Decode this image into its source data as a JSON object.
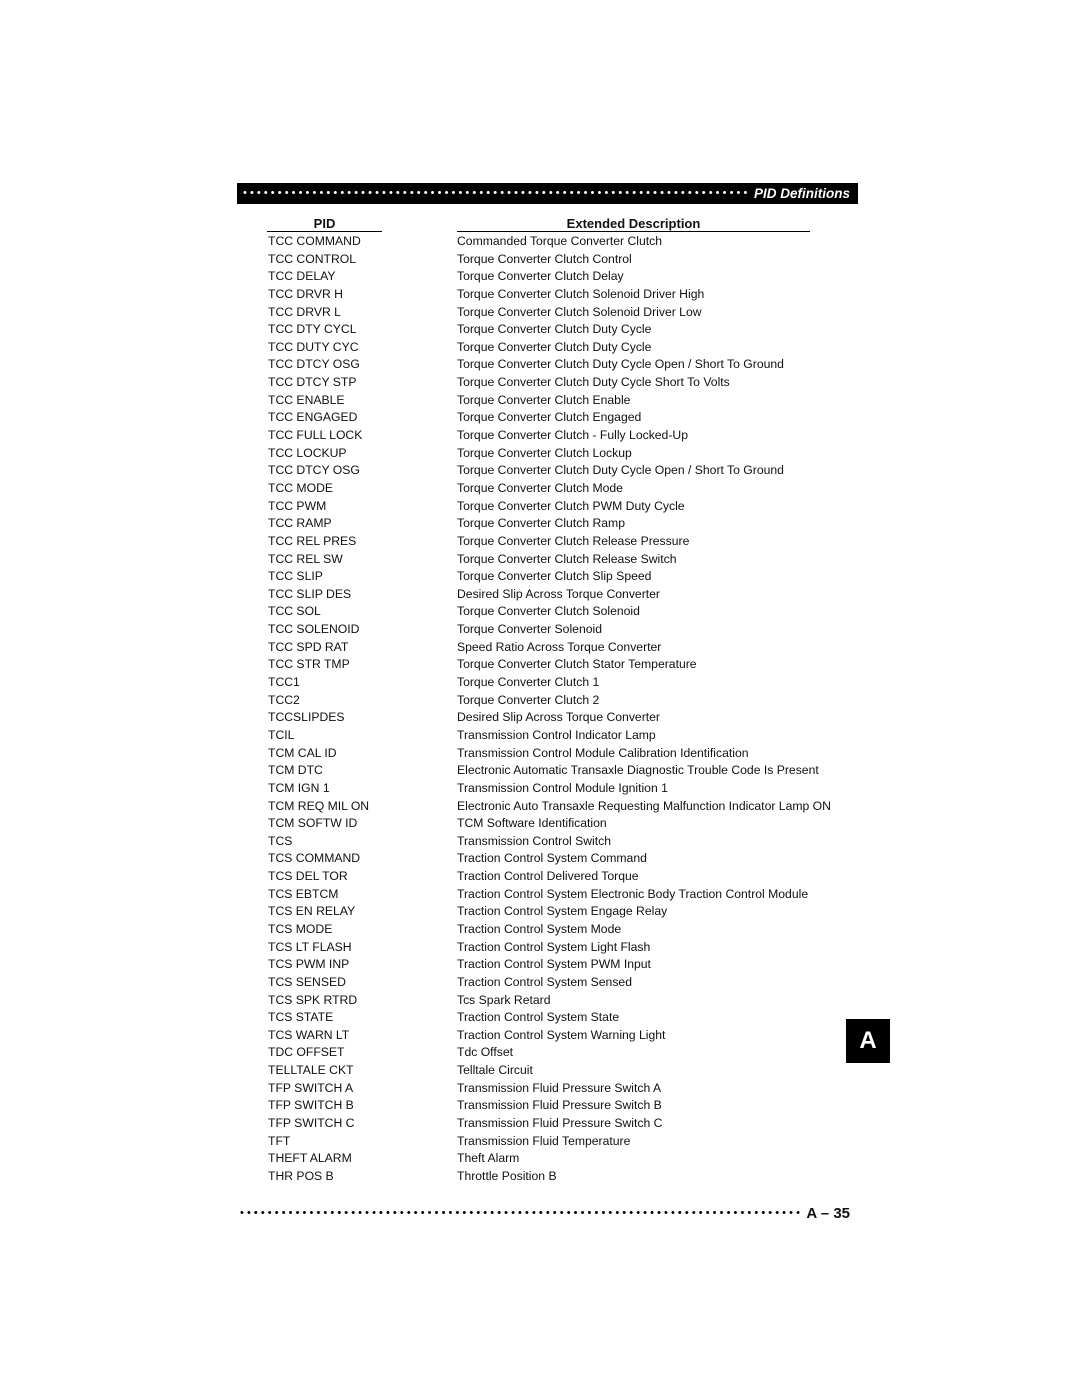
{
  "header": {
    "dots": "••••••••••••••••••••••••••••••••••••••••••••••••••••••••••••••••••••••••••••••••••••••••",
    "title": "PID Definitions"
  },
  "table": {
    "columns": {
      "pid": "PID",
      "description": "Extended Description"
    },
    "rows": [
      {
        "pid": "TCC COMMAND",
        "description": "Commanded Torque Converter Clutch"
      },
      {
        "pid": "TCC CONTROL",
        "description": "Torque Converter Clutch Control"
      },
      {
        "pid": "TCC DELAY",
        "description": "Torque Converter Clutch Delay"
      },
      {
        "pid": "TCC DRVR H",
        "description": "Torque Converter Clutch Solenoid Driver High"
      },
      {
        "pid": "TCC DRVR L",
        "description": "Torque Converter Clutch Solenoid Driver Low"
      },
      {
        "pid": "TCC DTY CYCL",
        "description": "Torque Converter Clutch Duty Cycle"
      },
      {
        "pid": "TCC DUTY CYC",
        "description": "Torque Converter Clutch Duty Cycle"
      },
      {
        "pid": "TCC DTCY OSG",
        "description": "Torque Converter Clutch Duty Cycle Open / Short To Ground"
      },
      {
        "pid": "TCC DTCY STP",
        "description": "Torque Converter Clutch Duty Cycle Short To Volts"
      },
      {
        "pid": "TCC ENABLE",
        "description": "Torque Converter Clutch Enable"
      },
      {
        "pid": "TCC ENGAGED",
        "description": "Torque Converter Clutch Engaged"
      },
      {
        "pid": "TCC FULL LOCK",
        "description": "Torque Converter Clutch - Fully Locked-Up"
      },
      {
        "pid": "TCC LOCKUP",
        "description": "Torque Converter Clutch Lockup"
      },
      {
        "pid": "TCC DTCY OSG",
        "description": "Torque Converter Clutch Duty Cycle Open / Short To Ground"
      },
      {
        "pid": "TCC MODE",
        "description": "Torque Converter Clutch Mode"
      },
      {
        "pid": "TCC PWM",
        "description": "Torque Converter Clutch PWM Duty Cycle"
      },
      {
        "pid": "TCC RAMP",
        "description": "Torque Converter Clutch Ramp"
      },
      {
        "pid": "TCC REL PRES",
        "description": "Torque Converter Clutch Release Pressure"
      },
      {
        "pid": "TCC REL SW",
        "description": "Torque Converter Clutch Release Switch"
      },
      {
        "pid": "TCC SLIP",
        "description": "Torque Converter Clutch Slip Speed"
      },
      {
        "pid": "TCC SLIP DES",
        "description": "Desired Slip Across Torque Converter"
      },
      {
        "pid": "TCC SOL",
        "description": "Torque Converter Clutch Solenoid"
      },
      {
        "pid": "TCC SOLENOID",
        "description": "Torque Converter Solenoid"
      },
      {
        "pid": "TCC SPD RAT",
        "description": "Speed Ratio Across Torque Converter"
      },
      {
        "pid": "TCC STR TMP",
        "description": "Torque Converter Clutch Stator Temperature"
      },
      {
        "pid": "TCC1",
        "description": "Torque Converter Clutch 1"
      },
      {
        "pid": "TCC2",
        "description": "Torque Converter Clutch 2"
      },
      {
        "pid": "TCCSLIPDES",
        "description": "Desired Slip Across Torque Converter"
      },
      {
        "pid": "TCIL",
        "description": "Transmission Control Indicator Lamp"
      },
      {
        "pid": "TCM CAL ID",
        "description": "Transmission Control Module Calibration Identification"
      },
      {
        "pid": "TCM DTC",
        "description": "Electronic Automatic Transaxle Diagnostic Trouble Code Is Present"
      },
      {
        "pid": "TCM IGN 1",
        "description": "Transmission Control Module Ignition 1"
      },
      {
        "pid": "TCM REQ MIL ON",
        "description": "Electronic Auto Transaxle Requesting Malfunction Indicator Lamp ON"
      },
      {
        "pid": "TCM SOFTW ID",
        "description": "TCM Software Identification"
      },
      {
        "pid": "TCS",
        "description": "Transmission Control Switch"
      },
      {
        "pid": "TCS COMMAND",
        "description": "Traction Control System Command"
      },
      {
        "pid": "TCS DEL TOR",
        "description": "Traction Control Delivered Torque"
      },
      {
        "pid": "TCS EBTCM",
        "description": "Traction Control System Electronic Body Traction Control Module"
      },
      {
        "pid": "TCS EN RELAY",
        "description": "Traction Control System Engage Relay"
      },
      {
        "pid": "TCS MODE",
        "description": "Traction Control System Mode"
      },
      {
        "pid": "TCS LT FLASH",
        "description": "Traction Control System Light Flash"
      },
      {
        "pid": "TCS PWM INP",
        "description": "Traction Control System PWM Input"
      },
      {
        "pid": "TCS SENSED",
        "description": "Traction Control System Sensed"
      },
      {
        "pid": "TCS SPK RTRD",
        "description": "Tcs Spark Retard"
      },
      {
        "pid": "TCS STATE",
        "description": "Traction Control System State"
      },
      {
        "pid": "TCS WARN LT",
        "description": "Traction Control System Warning Light"
      },
      {
        "pid": "TDC OFFSET",
        "description": "Tdc Offset"
      },
      {
        "pid": "TELLTALE CKT",
        "description": "Telltale Circuit"
      },
      {
        "pid": "TFP SWITCH A",
        "description": "Transmission Fluid Pressure Switch A"
      },
      {
        "pid": "TFP SWITCH B",
        "description": "Transmission Fluid Pressure Switch B"
      },
      {
        "pid": "TFP SWITCH C",
        "description": "Transmission Fluid Pressure Switch C"
      },
      {
        "pid": "TFT",
        "description": "Transmission Fluid Temperature"
      },
      {
        "pid": "THEFT ALARM",
        "description": "Theft Alarm"
      },
      {
        "pid": "THR POS B",
        "description": "Throttle Position B"
      }
    ]
  },
  "section_tab": {
    "letter": "A"
  },
  "footer": {
    "dots": "••••••••••••••••••••••••••••••••••••••••••••••••••••••••••••••••••••••••••••••••••••••••",
    "page_number": "A – 35"
  }
}
